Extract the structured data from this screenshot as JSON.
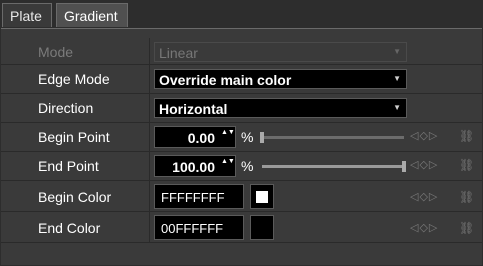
{
  "tabs": [
    {
      "label": "Plate",
      "active": false
    },
    {
      "label": "Gradient",
      "active": true
    }
  ],
  "rows": {
    "mode": {
      "label": "Mode",
      "value": "Linear",
      "disabled": true
    },
    "edge_mode": {
      "label": "Edge Mode",
      "value": "Override main color"
    },
    "direction": {
      "label": "Direction",
      "value": "Horizontal"
    },
    "begin_point": {
      "label": "Begin Point",
      "value": "0.00",
      "unit": "%",
      "slider_fraction": 0.0
    },
    "end_point": {
      "label": "End Point",
      "value": "100.00",
      "unit": "%",
      "slider_fraction": 1.0
    },
    "begin_color": {
      "label": "Begin Color",
      "value": "FFFFFFFF",
      "swatch_color": "#ffffff"
    },
    "end_color": {
      "label": "End Color",
      "value": "00FFFFFF",
      "swatch_color": "transparent"
    }
  },
  "icons": {
    "dropdown_arrow": "▼",
    "spin": "▲▼",
    "keyframe_nav": "◁◇▷",
    "link": "⛓"
  },
  "colors": {
    "background": "#2d2d2d",
    "panel": "#3a3a3a",
    "field": "#000000",
    "text": "#ffffff",
    "disabled_text": "#777777"
  }
}
